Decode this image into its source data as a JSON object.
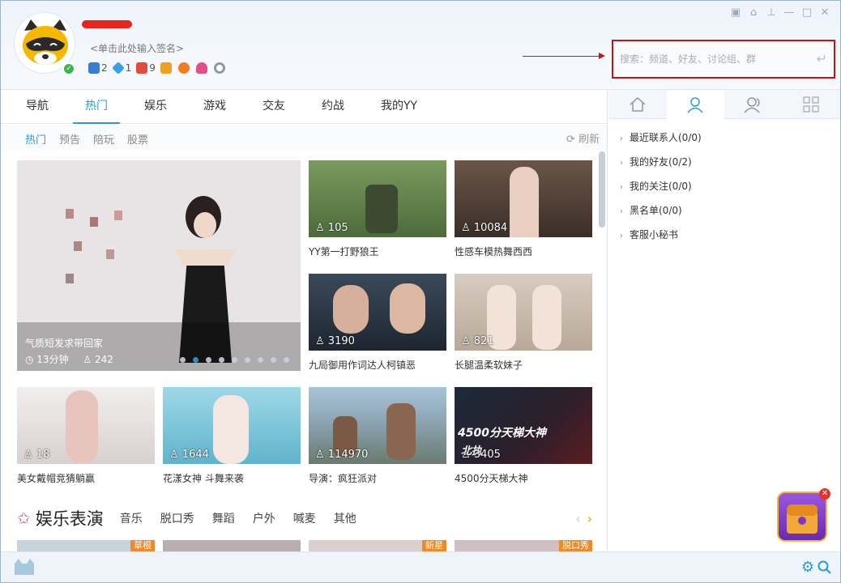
{
  "header": {
    "signature": "<单击此处输入签名>",
    "badges": [
      {
        "icon": "game-icon",
        "count": "2",
        "color": "#3a7bd5"
      },
      {
        "icon": "diamond-icon",
        "count": "1",
        "color": "#3aa0e0"
      },
      {
        "icon": "vip-icon",
        "count": "9",
        "color": "#e24b3a"
      },
      {
        "icon": "video-icon",
        "count": "",
        "color": "#f0a020"
      },
      {
        "icon": "pet-icon",
        "count": "",
        "color": "#f07d20"
      },
      {
        "icon": "heart-icon",
        "count": "",
        "color": "#e2508a"
      },
      {
        "icon": "eye-icon",
        "count": "",
        "color": "#8a98a8"
      }
    ],
    "search_placeholder": "搜索：频道、好友、讨论组、群"
  },
  "window_controls": [
    "skin-icon",
    "shirt-icon",
    "pin-icon",
    "minimize-icon",
    "maximize-icon",
    "close-icon"
  ],
  "nav": {
    "tabs": [
      "导航",
      "热门",
      "娱乐",
      "游戏",
      "交友",
      "约战",
      "我的YY"
    ],
    "active": "热门",
    "subtabs": [
      "热门",
      "预告",
      "陪玩",
      "股票"
    ],
    "refresh": "刷新"
  },
  "featured": {
    "caption": "气质短发求带回家",
    "duration": "13分钟",
    "viewers": "242"
  },
  "cards": [
    {
      "count": "105",
      "title": "YY第一打野狼王"
    },
    {
      "count": "10084",
      "title": "性感车模热舞西西"
    },
    {
      "count": "3190",
      "title": "九局御用作词达人柯镇恶"
    },
    {
      "count": "821",
      "title": "长腿温柔软妹子"
    },
    {
      "count": "18",
      "title": "美女戴帽竞猜躺赢"
    },
    {
      "count": "1644",
      "title": "花漾女神 斗舞来袭"
    },
    {
      "count": "114970",
      "title": "导演：疯狂派对"
    },
    {
      "count": "3405",
      "title": "4500分天梯大神",
      "overlay": "4500分天梯大神",
      "overlay2": "北执"
    }
  ],
  "section": {
    "title": "娱乐表演",
    "subtabs": [
      "音乐",
      "脱口秀",
      "舞蹈",
      "户外",
      "喊麦",
      "其他"
    ],
    "tags": [
      "草根",
      "新星",
      "脱口秀"
    ]
  },
  "contacts": [
    "最近联系人(0/0)",
    "我的好友(0/2)",
    "我的关注(0/0)",
    "黑名单(0/0)",
    "客服小秘书"
  ],
  "colors": {
    "accent": "#2c9ad9",
    "highlight": "#cc1111"
  }
}
